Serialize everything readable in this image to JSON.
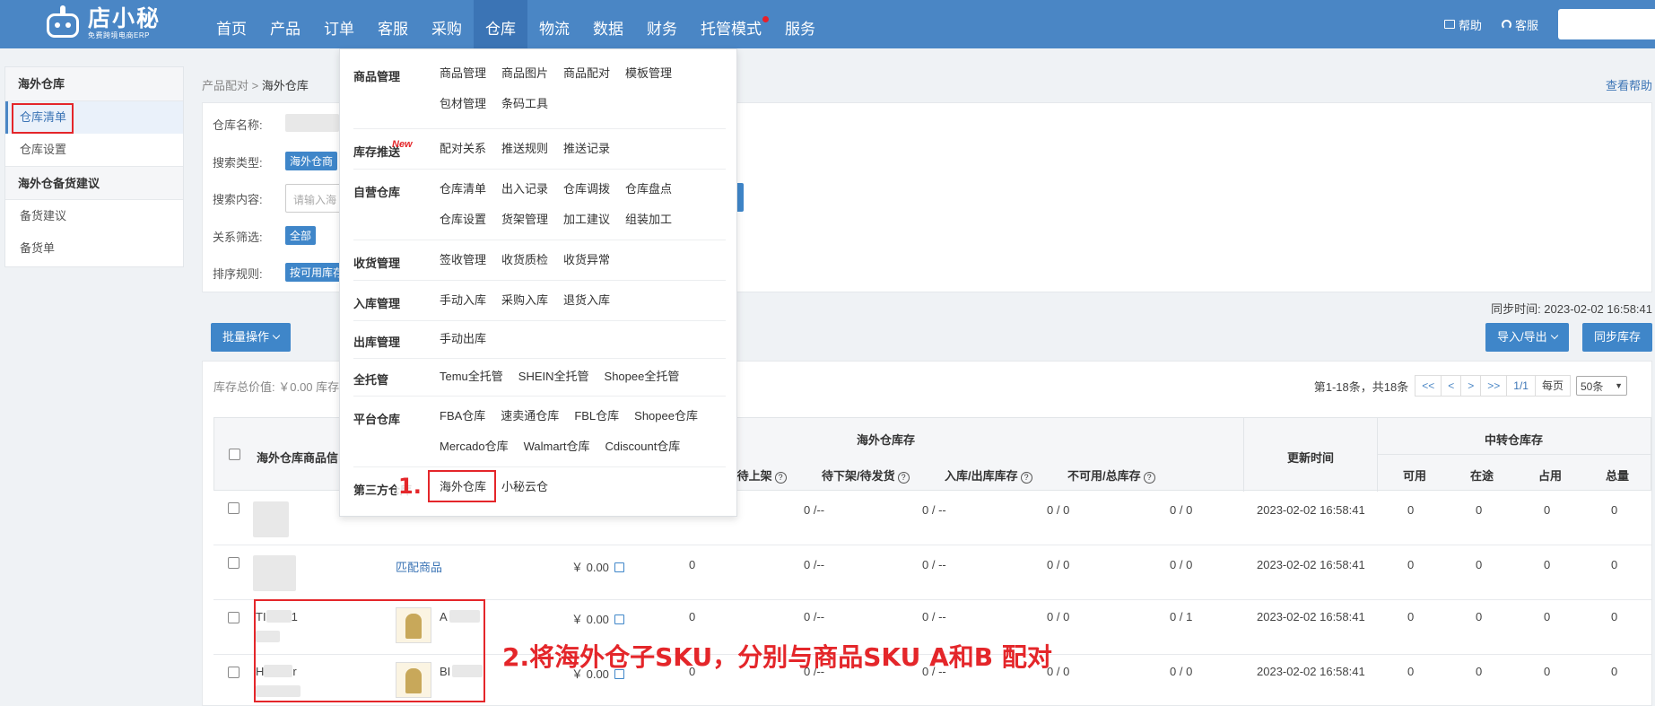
{
  "brand": {
    "name": "店小秘",
    "slogan": "免费跨境电商ERP"
  },
  "nav": {
    "items": [
      "首页",
      "产品",
      "订单",
      "客服",
      "采购",
      "仓库",
      "物流",
      "数据",
      "财务",
      "托管模式",
      "服务"
    ],
    "active": "仓库"
  },
  "top_right": {
    "help": "帮助",
    "service": "客服"
  },
  "sidebar": {
    "group1": "海外仓库",
    "item_list": "仓库清单",
    "item_settings": "仓库设置",
    "group2": "海外仓备货建议",
    "item_suggest": "备货建议",
    "item_order": "备货单"
  },
  "breadcrumb": {
    "parent": "产品配对",
    "current": "海外仓库"
  },
  "help_link": "查看帮助",
  "filter": {
    "warehouse_name_label": "仓库名称:",
    "search_type_label": "搜索类型:",
    "search_type_value": "海外仓商",
    "search_content_label": "搜索内容:",
    "search_placeholder": "请输入海",
    "relation_label": "关系筛选:",
    "relation_value": "全部",
    "sort_label": "排序规则:",
    "sort_value": "按可用库存"
  },
  "sync_time": "同步时间: 2023-02-02 16:58:41",
  "toolbar": {
    "batch": "批量操作",
    "import_export": "导入/导出",
    "sync_stock": "同步库存"
  },
  "table_panel": {
    "total_value": "库存总价值: ￥0.00 库存",
    "pager_info": "第1-18条，共18条",
    "pager_buttons": [
      "<<",
      "<",
      ">",
      ">>",
      "1/1"
    ],
    "per_page_label": "每页",
    "per_page_value": "50条"
  },
  "table": {
    "header_product": "海外仓库商品信",
    "group_overseas": "海外仓库存",
    "col_transit": "在途/待上架",
    "col_pending": "待下架/待发货",
    "col_inout": "入库/出库库存",
    "col_unavailable": "不可用/总库存",
    "col_updated": "更新时间",
    "group_transfer": "中转仓库存",
    "col_available": "可用",
    "col_in_transit": "在途",
    "col_occupied": "占用",
    "col_total": "总量",
    "rows": [
      {
        "sku": "",
        "match": "",
        "price": "",
        "qty": "",
        "transit": "0 /--",
        "pending": "0 / --",
        "inout": "0 / 0",
        "unavail": "0 / 0",
        "time": "2023-02-02 16:58:41",
        "available": "0",
        "in_transit": "0",
        "occupied": "0",
        "total": "0"
      },
      {
        "sku": "",
        "match": "匹配商品",
        "price": "￥ 0.00",
        "qty": "0",
        "transit": "0 /--",
        "pending": "0 / --",
        "inout": "0 / 0",
        "unavail": "0 / 0",
        "time": "2023-02-02 16:58:41",
        "available": "0",
        "in_transit": "0",
        "occupied": "0",
        "total": "0"
      },
      {
        "sku": "TI",
        "sku_suffix": "1",
        "match": "A",
        "price": "￥ 0.00",
        "qty": "0",
        "transit": "0 /--",
        "pending": "0 / --",
        "inout": "0 / 0",
        "unavail": "0 / 1",
        "time": "2023-02-02 16:58:41",
        "available": "0",
        "in_transit": "0",
        "occupied": "0",
        "total": "0"
      },
      {
        "sku": "H",
        "sku_suffix": "r",
        "match": "BI",
        "price": "￥ 0.00",
        "qty": "0",
        "transit": "0 /--",
        "pending": "0 / --",
        "inout": "0 / 0",
        "unavail": "0 / 0",
        "time": "2023-02-02 16:58:41",
        "available": "0",
        "in_transit": "0",
        "occupied": "0",
        "total": "0"
      }
    ]
  },
  "dropdown": {
    "new_badge": "New",
    "sections": [
      {
        "cat": "商品管理",
        "links": [
          "商品管理",
          "商品图片",
          "商品配对",
          "模板管理",
          "包材管理",
          "条码工具"
        ]
      },
      {
        "cat": "库存推送",
        "links": [
          "配对关系",
          "推送规则",
          "推送记录"
        ]
      },
      {
        "cat": "自营仓库",
        "links": [
          "仓库清单",
          "出入记录",
          "仓库调拨",
          "仓库盘点",
          "仓库设置",
          "货架管理",
          "加工建议",
          "组装加工"
        ]
      },
      {
        "cat": "收货管理",
        "links": [
          "签收管理",
          "收货质检",
          "收货异常"
        ]
      },
      {
        "cat": "入库管理",
        "links": [
          "手动入库",
          "采购入库",
          "退货入库"
        ]
      },
      {
        "cat": "出库管理",
        "links": [
          "手动出库"
        ]
      },
      {
        "cat": "全托管",
        "links": [
          "Temu全托管",
          "SHEIN全托管",
          "Shopee全托管"
        ]
      },
      {
        "cat": "平台仓库",
        "links": [
          "FBA仓库",
          "速卖通仓库",
          "FBL仓库",
          "Shopee仓库",
          "Mercado仓库",
          "Walmart仓库",
          "Cdiscount仓库"
        ]
      },
      {
        "cat": "第三方仓库",
        "links": [
          "海外仓库",
          "小秘云仓"
        ]
      }
    ]
  },
  "annotations": {
    "step1": "1.",
    "step2": "2.将海外仓子SKU，分别与商品SKU A和B 配对"
  },
  "colors": {
    "topbar": "#4a86c5",
    "accent": "#3f86c9",
    "annotation": "#e4262a"
  }
}
